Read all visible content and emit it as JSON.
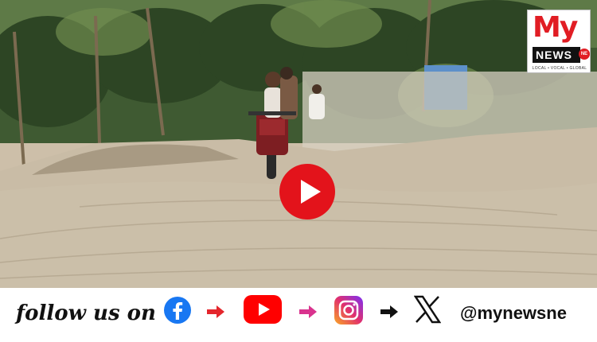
{
  "video": {
    "play_button_icon": "play-icon"
  },
  "logo": {
    "my": "My",
    "news": "NEWS",
    "ne": "NE",
    "tagline": "LOCAL • VOCAL • GLOBAL"
  },
  "footer": {
    "follow_text": "follow us on",
    "handle": "@mynewsne",
    "icons": [
      "facebook-icon",
      "youtube-icon",
      "instagram-icon",
      "x-icon"
    ],
    "arrow_colors": [
      "#e4262c",
      "#d9338e",
      "#111111"
    ]
  },
  "colors": {
    "brand_red": "#e11d24",
    "play_red": "#e3131b"
  }
}
